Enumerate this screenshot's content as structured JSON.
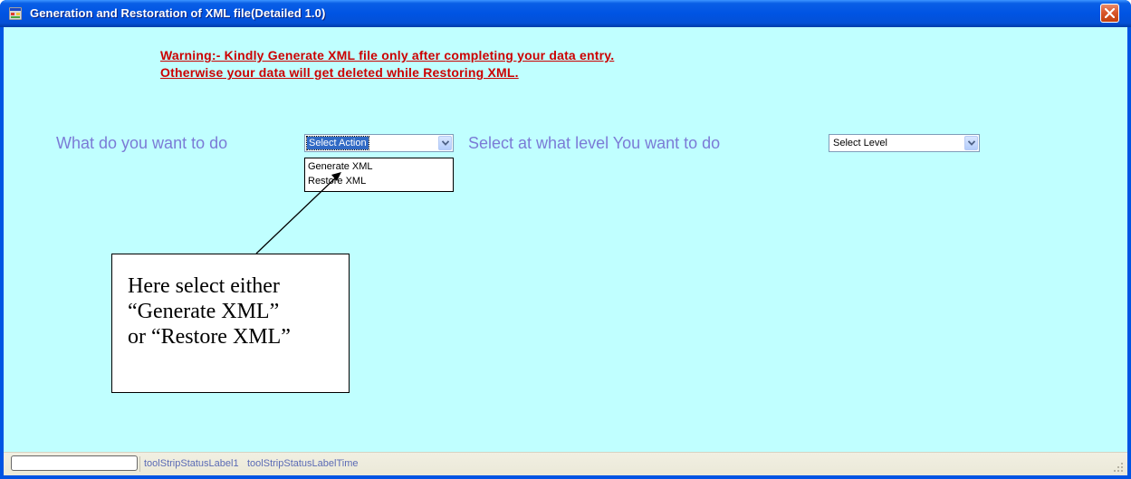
{
  "window": {
    "title": "Generation and Restoration of XML file(Detailed 1.0)",
    "icon": "app-window-icon"
  },
  "warning": {
    "line1": "Warning:- Kindly Generate XML file only after completing your data entry.",
    "line2": "Otherwise your data will get deleted while Restoring XML.",
    "color": "#cc0000"
  },
  "form": {
    "action_label": "What do you want to do",
    "action_select": {
      "value": "Select Action",
      "options": [
        "Generate XML",
        "Restore XML"
      ],
      "expanded": true
    },
    "level_label": "Select at what level You want to do",
    "level_select": {
      "value": "Select Level"
    },
    "label_color": "#7b7bd6",
    "background_color": "#c0ffff"
  },
  "callout": {
    "line1": "Here select either",
    "line2": "“Generate XML”",
    "line3": "or “Restore XML”"
  },
  "statusbar": {
    "label1": "toolStripStatusLabel1",
    "label2": "toolStripStatusLabelTime"
  }
}
